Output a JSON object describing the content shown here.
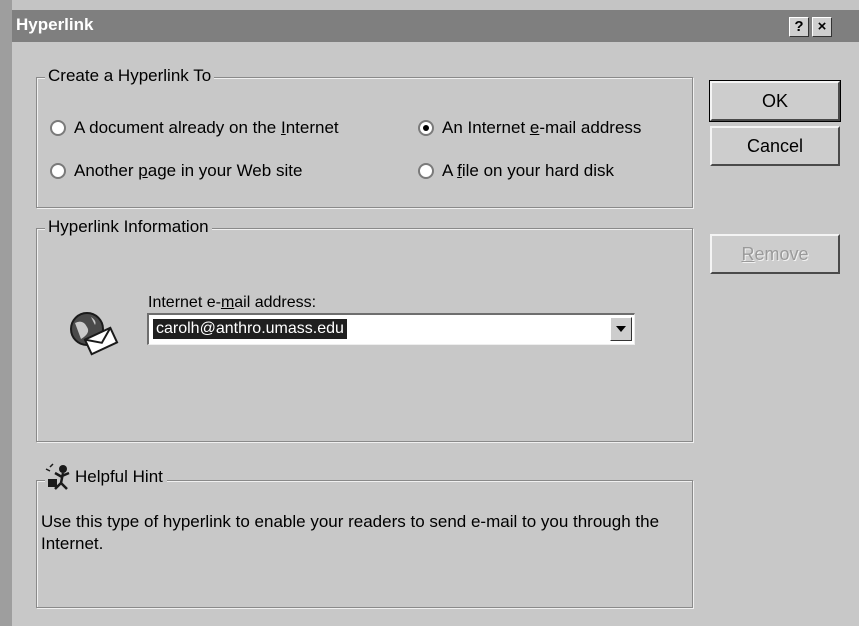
{
  "window": {
    "title": "Hyperlink",
    "help_glyph": "?",
    "close_glyph": "×"
  },
  "create_group": {
    "label": "Create a Hyperlink To",
    "options": [
      {
        "pre": "A document already on the ",
        "key": "I",
        "post": "nternet",
        "selected": false
      },
      {
        "pre": "An Internet ",
        "key": "e",
        "post": "-mail address",
        "selected": true
      },
      {
        "pre": "Another ",
        "key": "p",
        "post": "age in your Web site",
        "selected": false
      },
      {
        "pre": "A ",
        "key": "f",
        "post": "ile on your hard disk",
        "selected": false
      }
    ]
  },
  "buttons": {
    "ok_label": "OK",
    "cancel_label": "Cancel",
    "remove_key": "R",
    "remove_rest": "emove"
  },
  "info_group": {
    "label": "Hyperlink Information",
    "field_pre": "Internet e-",
    "field_key": "m",
    "field_post": "ail address:",
    "field_value": "carolh@anthro.umass.edu"
  },
  "hint_group": {
    "label": "Helpful Hint",
    "text": "Use this type of hyperlink to enable your readers to send e-mail to you through the Internet."
  }
}
